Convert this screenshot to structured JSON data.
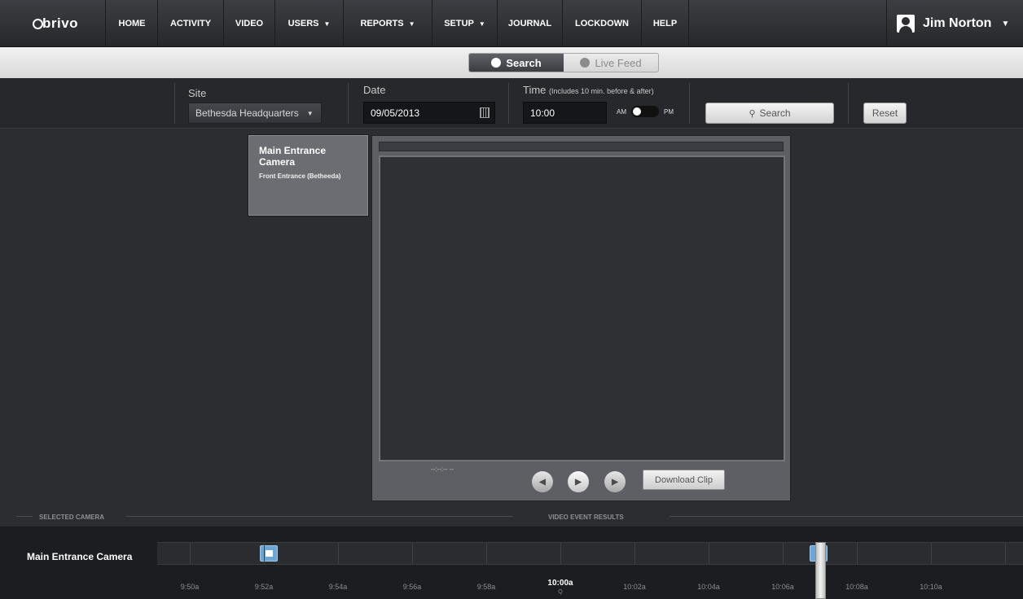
{
  "nav": {
    "logo": "brivo",
    "items": [
      {
        "label": "HOME",
        "caret": false
      },
      {
        "label": "ACTIVITY",
        "caret": false
      },
      {
        "label": "VIDEO",
        "caret": false
      },
      {
        "label": "USERS",
        "caret": true
      },
      {
        "label": "REPORTS",
        "caret": true
      },
      {
        "label": "SETUP",
        "caret": true
      },
      {
        "label": "JOURNAL",
        "caret": false
      },
      {
        "label": "LOCKDOWN",
        "caret": false
      },
      {
        "label": "HELP",
        "caret": false
      }
    ],
    "user_name": "Jim Norton"
  },
  "mode": {
    "search_label": "Search",
    "live_label": "Live Feed",
    "active": "Search"
  },
  "filters": {
    "site_label": "Site",
    "site_value": "Bethesda Headquarters",
    "date_label": "Date",
    "date_value": "09/05/2013",
    "time_label": "Time",
    "time_note": "(Includes 10 min. before & after)",
    "time_value": "10:00",
    "am_label": "AM",
    "pm_label": "PM",
    "search_button": "Search",
    "reset_button": "Reset"
  },
  "camera_card": {
    "title": "Main Entrance Camera",
    "subtitle": "Front Entrance (Betheeda)"
  },
  "player": {
    "timecode": "--:--:-- --",
    "download_label": "Download Clip"
  },
  "timeline": {
    "selected_camera_heading": "SELECTED CAMERA",
    "results_heading": "VIDEO EVENT RESULTS",
    "camera_name": "Main Entrance Camera",
    "time_labels": [
      "9:50a",
      "9:52a",
      "9:54a",
      "9:56a",
      "9:58a",
      "10:00a",
      "10:02a",
      "10:04a",
      "10:06a",
      "10:08a",
      "10:10a"
    ],
    "current_time": "10:00a",
    "current_time_sub": "Q"
  },
  "colors": {
    "event_marker": "#6aa6d6",
    "nav_bg": "#2f3135",
    "page_bg": "#2b2d31"
  }
}
